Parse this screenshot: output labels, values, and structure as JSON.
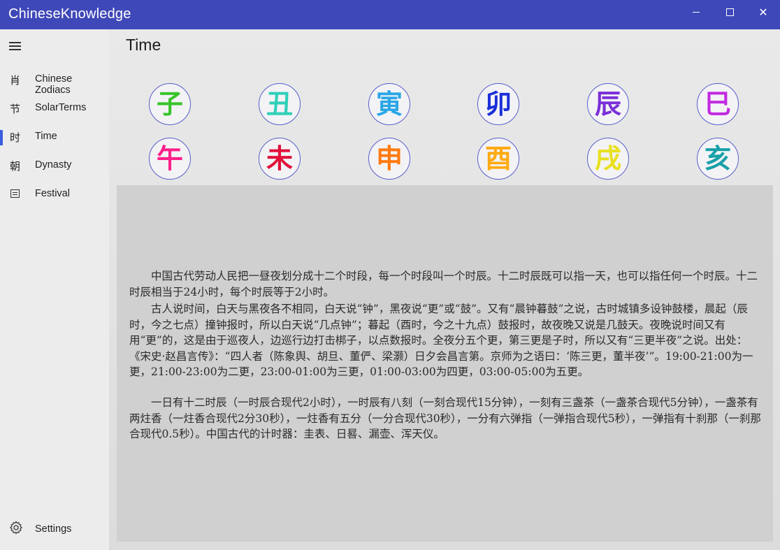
{
  "window": {
    "title": "ChineseKnowledge",
    "minimize_icon": "minimize-icon",
    "maximize_icon": "maximize-icon",
    "close_icon": "close-icon",
    "titlebar_color": "#3f48b8"
  },
  "sidebar": {
    "menu_icon": "hamburger-menu-icon",
    "items": [
      {
        "glyph": "肖",
        "label": "Chinese Zodiacs"
      },
      {
        "glyph": "节",
        "label": "SolarTerms"
      },
      {
        "glyph": "时",
        "label": "Time"
      },
      {
        "glyph": "朝",
        "label": "Dynasty"
      },
      {
        "icon": "calendar-icon",
        "label": "Festival"
      }
    ],
    "selected": "Time",
    "accent_color": "#3a5ddd",
    "settings": {
      "icon": "gear-icon",
      "label": "Settings"
    }
  },
  "page": {
    "title": "Time",
    "branches": [
      {
        "char": "子",
        "color": "#39c42a"
      },
      {
        "char": "丑",
        "color": "#2fd0b8"
      },
      {
        "char": "寅",
        "color": "#2aa6e6"
      },
      {
        "char": "卯",
        "color": "#1a2fd8"
      },
      {
        "char": "辰",
        "color": "#7a2fd8"
      },
      {
        "char": "巳",
        "color": "#c22ae0"
      },
      {
        "char": "午",
        "color": "#ff1f8a"
      },
      {
        "char": "未",
        "color": "#e0103a"
      },
      {
        "char": "申",
        "color": "#ff7a10"
      },
      {
        "char": "酉",
        "color": "#ffaa10"
      },
      {
        "char": "戌",
        "color": "#e8e020"
      },
      {
        "char": "亥",
        "color": "#18a0a8"
      }
    ],
    "paragraphs": [
      "中国古代劳动人民把一昼夜划分成十二个时段，每一个时段叫一个时辰。十二时辰既可以指一天，也可以指任何一个时辰。十二时辰相当于24小时，每个时辰等于2小时。",
      "古人说时间，白天与黑夜各不相同，白天说“钟”，黑夜说“更”或“鼓”。又有“晨钟暮鼓”之说，古时城镇多设钟鼓楼，晨起（辰时，今之七点）撞钟报时，所以白天说“几点钟”；暮起（酉时，今之十九点）鼓报时，故夜晚又说是几鼓天。夜晚说时间又有用“更”的，这是由于巡夜人，边巡行边打击梆子，以点数报时。全夜分五个更，第三更是子时，所以又有“三更半夜”之说。出处：《宋史·赵昌言传》：“四人者（陈象舆、胡旦、董俨、梁灏）日夕会昌言第。京师为之语曰：‘陈三更，董半夜’”。19:00-21:00为一更，21:00-23:00为二更，23:00-01:00为三更，01:00-03:00为四更，03:00-05:00为五更。",
      "一日有十二时辰（一时辰合现代2小时），一时辰有八刻（一刻合现代15分钟），一刻有三盏茶（一盏茶合现代5分钟），一盏茶有两炷香（一炷香合现代2分30秒），一炷香有五分（一分合现代30秒），一分有六弹指（一弹指合现代5秒），一弹指有十刹那（一刹那合现代0.5秒）。中国古代的计时器：圭表、日晷、漏壶、浑天仪。"
    ]
  }
}
